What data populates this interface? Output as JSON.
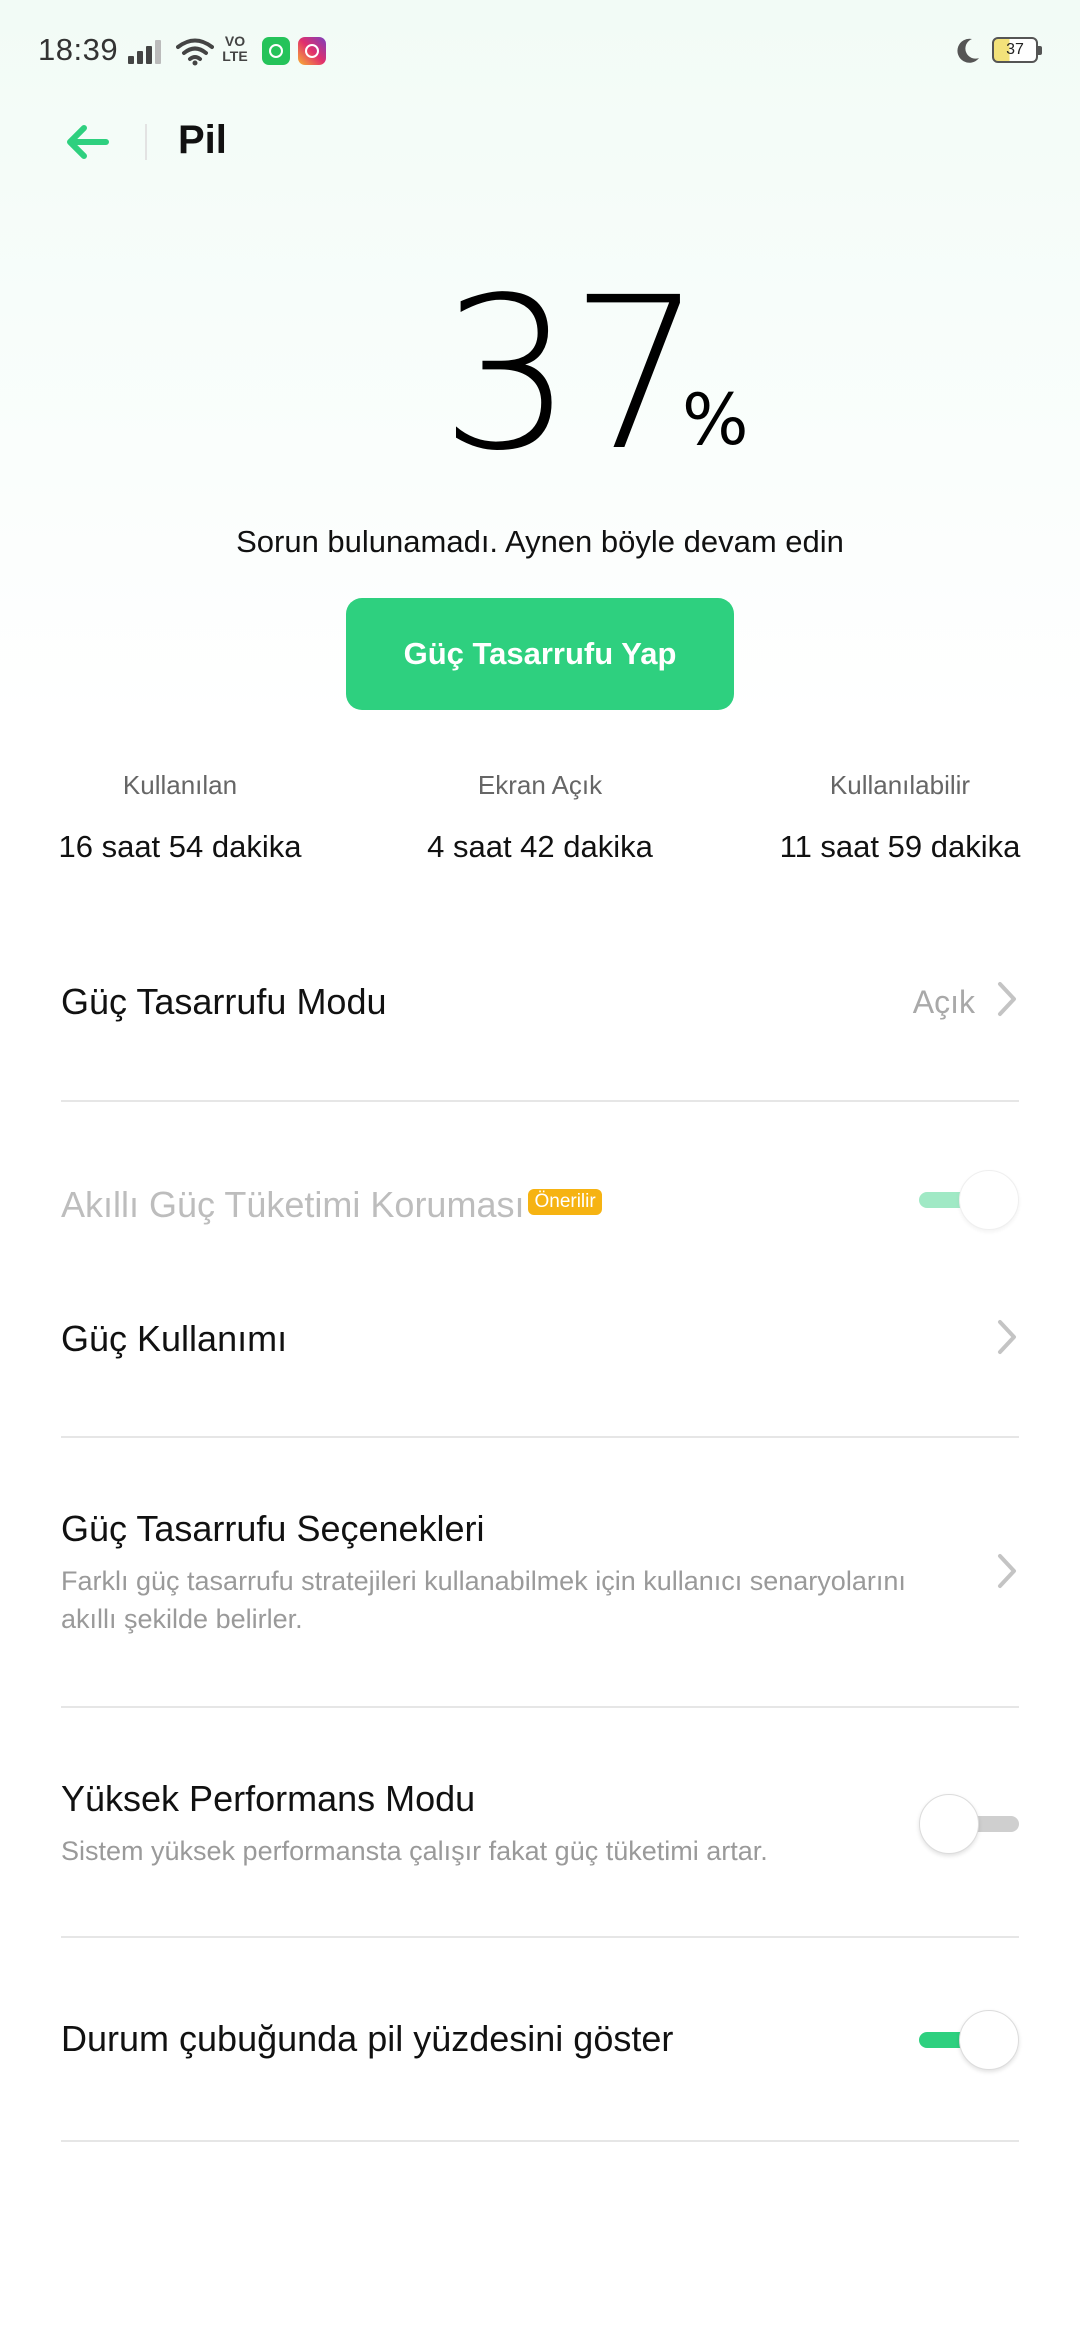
{
  "status_bar": {
    "time": "18:39",
    "volte": "VO\nLTE",
    "battery": "37",
    "icons": [
      "signal-icon",
      "wifi-icon",
      "volte-icon",
      "whatsapp-icon",
      "instagram-icon",
      "moon-icon",
      "battery-icon"
    ]
  },
  "header": {
    "back_icon": "arrow-left-icon",
    "title": "Pil"
  },
  "battery": {
    "percent": "37",
    "percent_sign": "%",
    "message": "Sorun bulunamadı. Aynen böyle devam edin",
    "save_button": "Güç Tasarrufu Yap"
  },
  "stats": [
    {
      "label": "Kullanılan",
      "value": "16 saat 54 dakika"
    },
    {
      "label": "Ekran Açık",
      "value": "4 saat 42 dakika"
    },
    {
      "label": "Kullanılabilir",
      "value": "11 saat 59 dakika"
    }
  ],
  "settings": {
    "power_saving_mode": {
      "title": "Güç Tasarrufu Modu",
      "value": "Açık"
    },
    "smart_protection": {
      "title": "Akıllı Güç Tüketimi Koruması",
      "badge": "Önerilir",
      "enabled": true,
      "disabled": true
    },
    "power_usage": {
      "title": "Güç Kullanımı"
    },
    "saving_options": {
      "title": "Güç Tasarrufu Seçenekleri",
      "subtitle": "Farklı güç tasarrufu stratejileri kullanabilmek için kullanıcı senaryolarını akıllı şekilde belirler."
    },
    "high_performance": {
      "title": "Yüksek Performans Modu",
      "subtitle": "Sistem yüksek performansta çalışır fakat güç tüketimi artar.",
      "enabled": false
    },
    "show_percentage": {
      "title": "Durum çubuğunda pil yüzdesini göster",
      "enabled": true
    }
  },
  "colors": {
    "accent": "#2ed07f",
    "badge": "#f6b312"
  }
}
